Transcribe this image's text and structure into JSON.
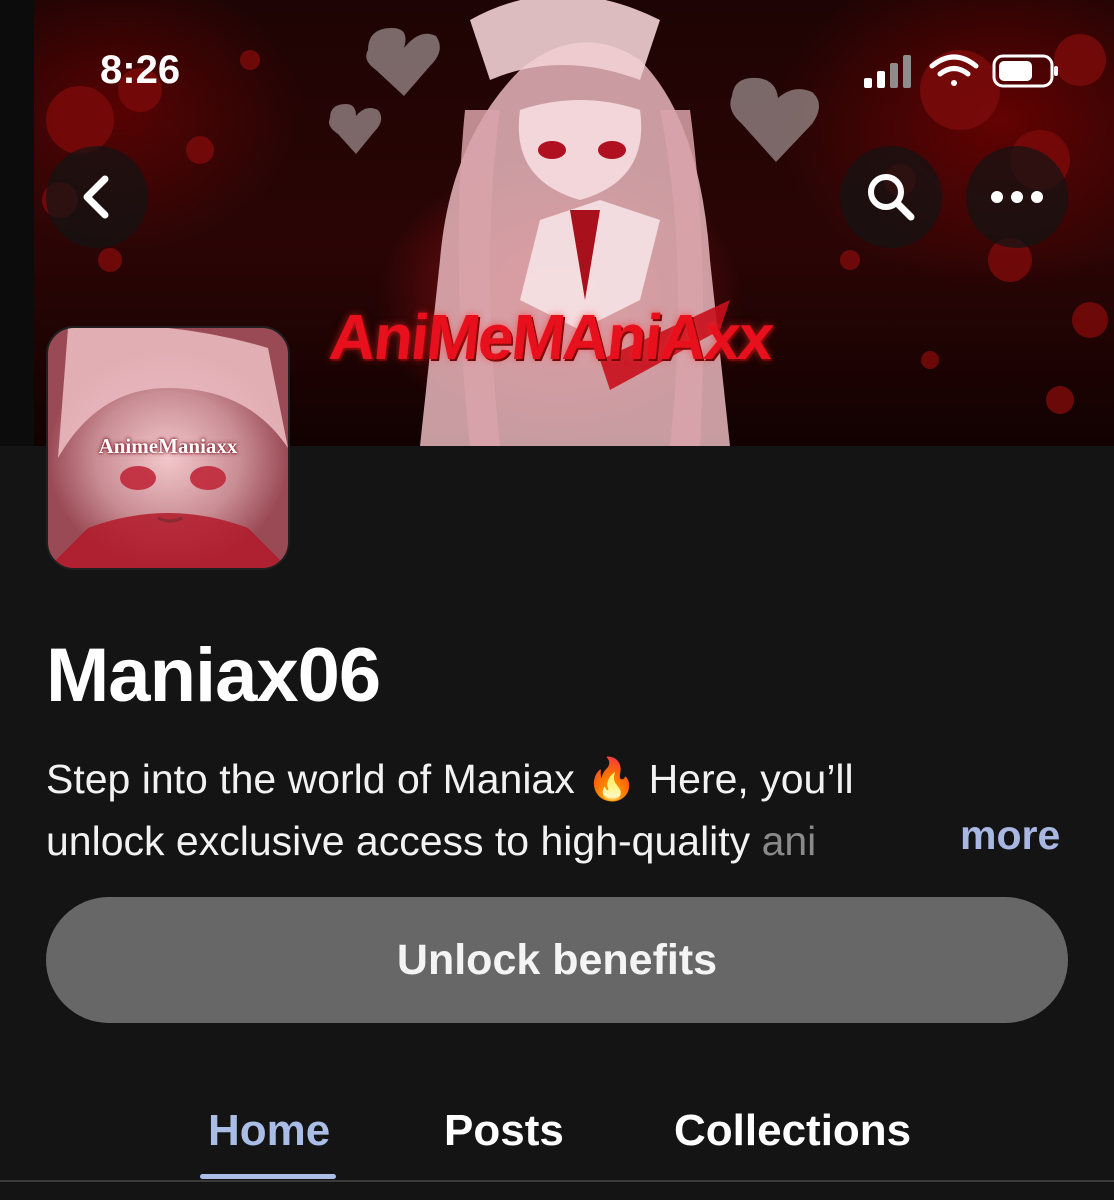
{
  "status_bar": {
    "time": "8:26",
    "icons": [
      "signal-icon",
      "wifi-icon",
      "battery-icon"
    ]
  },
  "banner": {
    "logo_text": "AniMeMAniAxx"
  },
  "nav": {
    "back_icon": "chevron-left-icon",
    "search_icon": "search-icon",
    "more_icon": "more-horizontal-icon"
  },
  "avatar": {
    "label": "AnimeManiaxx"
  },
  "profile": {
    "name": "Maniax06",
    "bio_line1": "Step into the world of Maniax 🔥 Here, you’ll",
    "bio_line2_main": "unlock exclusive access to high-quality ",
    "bio_line2_fade": "ani",
    "more_label": "more"
  },
  "actions": {
    "unlock_label": "Unlock benefits"
  },
  "tabs": [
    {
      "label": "Home",
      "active": true
    },
    {
      "label": "Posts",
      "active": false
    },
    {
      "label": "Collections",
      "active": false
    }
  ],
  "colors": {
    "background": "#141414",
    "accent_link": "#a9b7e3",
    "button_bg": "#676767",
    "banner_red": "#e8101c"
  }
}
